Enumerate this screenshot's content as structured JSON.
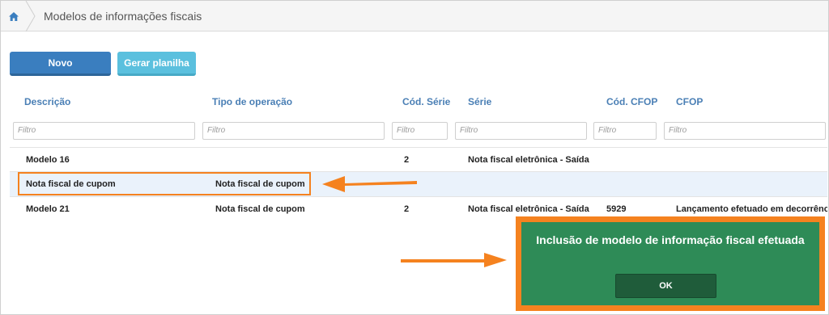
{
  "breadcrumb": {
    "home_icon": "home-icon",
    "title": "Modelos de informações fiscais"
  },
  "toolbar": {
    "novo_label": "Novo",
    "gerar_label": "Gerar planilha"
  },
  "table": {
    "columns": [
      "Descrição",
      "Tipo de operação",
      "Cód. Série",
      "Série",
      "Cód. CFOP",
      "CFOP"
    ],
    "filter_placeholder": "Filtro",
    "rows": [
      {
        "descricao": "Modelo 16",
        "tipo": "",
        "cod_serie": "2",
        "serie": "Nota fiscal eletrônica - Saída",
        "cod_cfop": "",
        "cfop": ""
      },
      {
        "descricao": "Nota fiscal de cupom",
        "tipo": "Nota fiscal de cupom",
        "cod_serie": "",
        "serie": "",
        "cod_cfop": "",
        "cfop": ""
      },
      {
        "descricao": "Modelo 21",
        "tipo": "Nota fiscal de cupom",
        "cod_serie": "2",
        "serie": "Nota fiscal eletrônica - Saída",
        "cod_cfop": "5929",
        "cfop": "Lançamento efetuado em decorrência"
      }
    ]
  },
  "modal": {
    "message": "Inclusão de modelo de informação fiscal efetuada",
    "ok_label": "OK"
  },
  "colors": {
    "primary": "#3a7ebf",
    "info": "#5bc0de",
    "header_text": "#4a7fb5",
    "annotation": "#f5821f",
    "modal_bg": "#2e8b57",
    "modal_button": "#1f5c3a"
  }
}
